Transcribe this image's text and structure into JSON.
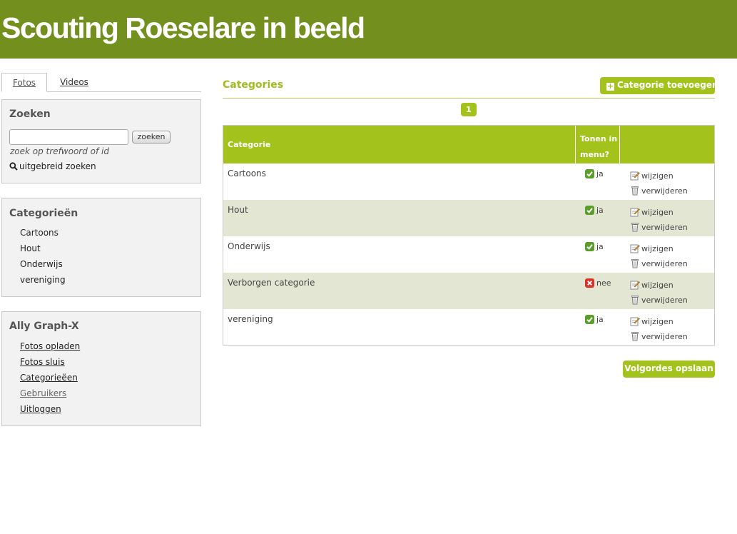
{
  "header": {
    "title": "Scouting Roeselare in beeld"
  },
  "tabs": [
    {
      "label": "Fotos",
      "active": true
    },
    {
      "label": "Videos",
      "active": false
    }
  ],
  "search": {
    "title": "Zoeken",
    "input_value": "",
    "button_label": "zoeken",
    "hint": "zoek op trefwoord of id",
    "advanced_label": "uitgebreid zoeken"
  },
  "categories_box": {
    "title": "Categorieën",
    "items": [
      "Cartoons",
      "Hout",
      "Onderwijs",
      "vereniging"
    ]
  },
  "admin_box": {
    "title": "Ally Graph-X",
    "items": [
      "Fotos opladen",
      "Fotos sluis",
      "Categorieëen",
      "Gebruikers",
      "Uitloggen"
    ]
  },
  "main": {
    "title": "Categories",
    "add_button": "Categorie toevoegen",
    "page": "1",
    "save_button": "Volgordes opslaan",
    "columns": {
      "name": "Categorie",
      "show": "Tonen in menu?"
    },
    "actions": {
      "edit": "wijzigen",
      "delete": "verwijderen"
    },
    "rows": [
      {
        "name": "Cartoons",
        "show": "ja",
        "visible": true
      },
      {
        "name": "Hout",
        "show": "ja",
        "visible": true
      },
      {
        "name": "Onderwijs",
        "show": "ja",
        "visible": true
      },
      {
        "name": "Verborgen categorie",
        "show": "nee",
        "visible": false
      },
      {
        "name": "vereniging",
        "show": "ja",
        "visible": true
      }
    ]
  },
  "colors": {
    "header_bg": "#738f1e",
    "accent": "#a3c21c",
    "row_alt": "#e3e6d3",
    "yes_icon": "#5a9e2a",
    "no_icon": "#d9322b"
  },
  "icons": {
    "search": "magnifier-icon",
    "add": "plus-icon",
    "yes": "check-icon",
    "no": "cross-icon",
    "edit": "pencil-icon",
    "delete": "trash-icon"
  }
}
